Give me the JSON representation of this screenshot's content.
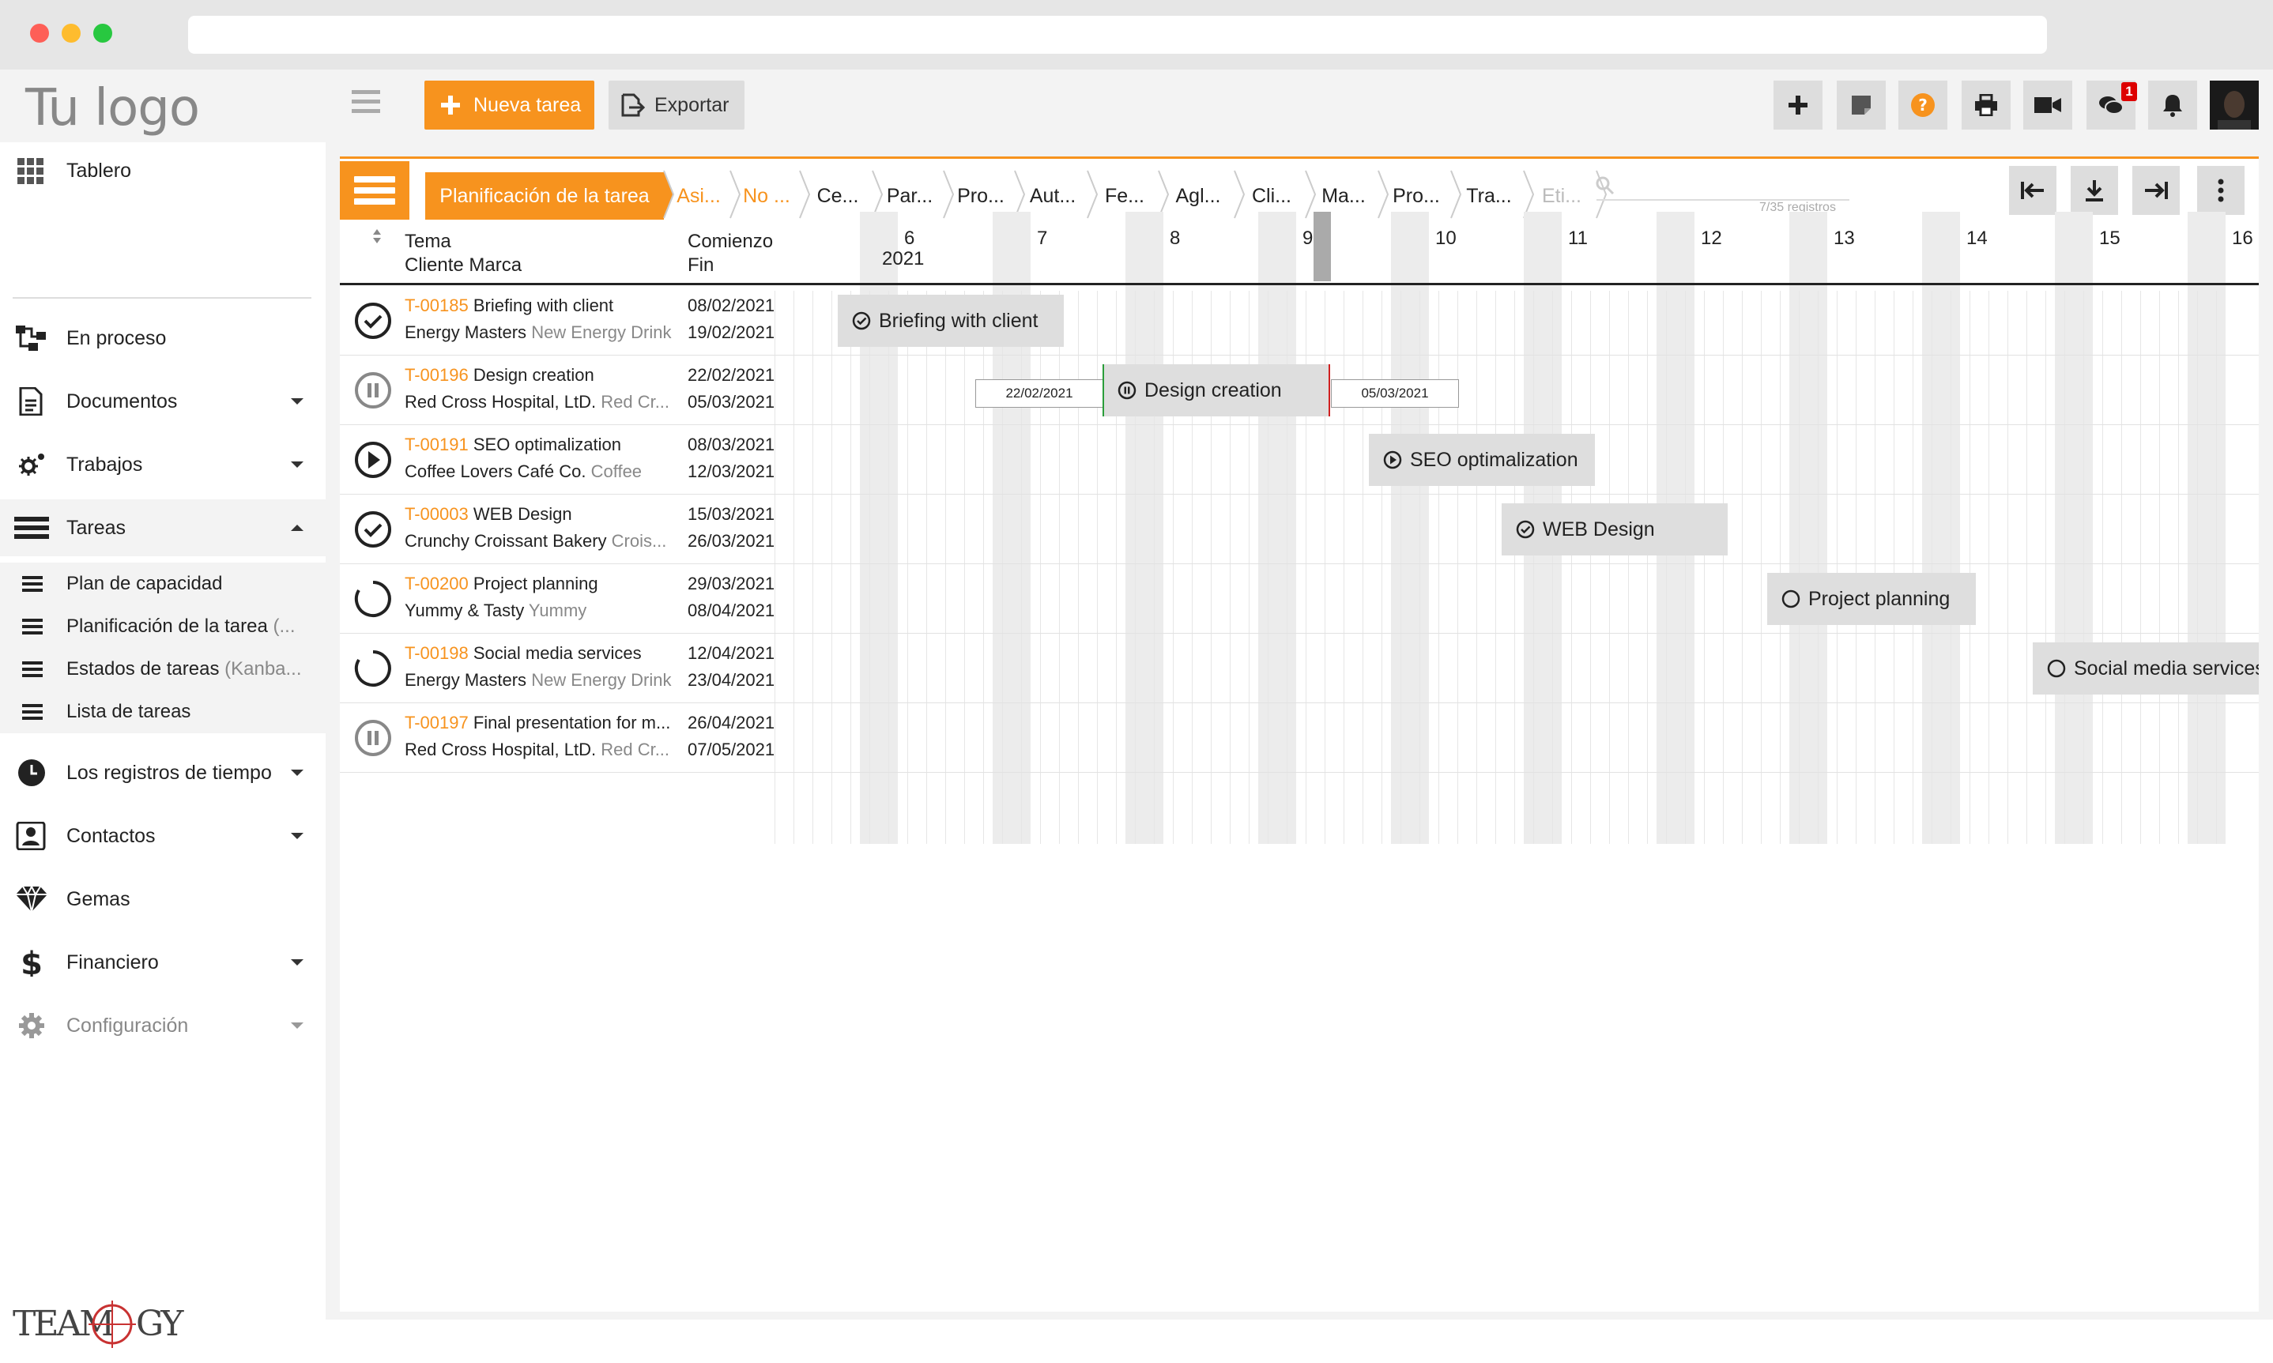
{
  "app": {
    "logo_text": "Tu logo",
    "brand_footer": "TEAMOGY",
    "accent": "#f7931e"
  },
  "toolbar": {
    "new_task_label": "Nueva tarea",
    "export_label": "Exportar",
    "notification_badge": "1",
    "icons": [
      "plus-icon",
      "sticky-note-icon",
      "help-icon",
      "print-icon",
      "video-icon",
      "chat-icon",
      "bell-icon"
    ]
  },
  "sidebar": {
    "items": [
      {
        "label": "Tablero"
      },
      {
        "label": "En proceso"
      },
      {
        "label": "Documentos"
      },
      {
        "label": "Trabajos"
      },
      {
        "label": "Tareas"
      },
      {
        "label": "Los registros de tiempo"
      },
      {
        "label": "Contactos"
      },
      {
        "label": "Gemas"
      },
      {
        "label": "Financiero"
      },
      {
        "label": "Configuración"
      }
    ],
    "sub": [
      {
        "label": "Plan de capacidad",
        "extra": ""
      },
      {
        "label": "Planificación de la tarea",
        "extra": "(..."
      },
      {
        "label": "Estados de tareas",
        "extra": "(Kanba..."
      },
      {
        "label": "Lista de tareas",
        "extra": ""
      }
    ]
  },
  "breadcrumbs": [
    "Planificación de la tarea",
    "Asi...",
    "No ...",
    "Ce...",
    "Par...",
    "Pro...",
    "Aut...",
    "Fe...",
    "Agl...",
    "Cli...",
    "Ma...",
    "Pro...",
    "Tra...",
    "Eti..."
  ],
  "records": "7/35 registros",
  "columns": {
    "tema": "Tema",
    "cliente_marca": "Cliente Marca",
    "comienzo": "Comienzo",
    "fin": "Fin"
  },
  "timeline": {
    "days": [
      "6",
      "7",
      "8",
      "9",
      "10",
      "11",
      "12",
      "13",
      "14",
      "15",
      "16"
    ],
    "year": "2021"
  },
  "tasks": [
    {
      "id": "T-00185",
      "title": "Briefing with client",
      "client": "Energy Masters",
      "brand": "New Energy Drink",
      "start": "08/02/2021",
      "end": "19/02/2021",
      "status": "done",
      "bar": "Briefing with client"
    },
    {
      "id": "T-00196",
      "title": "Design creation",
      "client": "Red Cross Hospital, LtD.",
      "brand": "Red Cr...",
      "start": "22/02/2021",
      "end": "05/03/2021",
      "status": "paused",
      "bar": "Design creation",
      "bar_start": "22/02/2021",
      "bar_end": "05/03/2021"
    },
    {
      "id": "T-00191",
      "title": "SEO optimalization",
      "client": "Coffee Lovers Café Co.",
      "brand": "Coffee",
      "start": "08/03/2021",
      "end": "12/03/2021",
      "status": "playing",
      "bar": "SEO optimalization"
    },
    {
      "id": "T-00003",
      "title": "WEB Design",
      "client": "Crunchy Croissant Bakery",
      "brand": "Crois...",
      "start": "15/03/2021",
      "end": "26/03/2021",
      "status": "done",
      "bar": "WEB Design"
    },
    {
      "id": "T-00200",
      "title": "Project planning",
      "client": "Yummy & Tasty",
      "brand": "Yummy",
      "start": "29/03/2021",
      "end": "08/04/2021",
      "status": "open",
      "bar": "Project planning"
    },
    {
      "id": "T-00198",
      "title": "Social media services",
      "client": "Energy Masters",
      "brand": "New Energy Drink",
      "start": "12/04/2021",
      "end": "23/04/2021",
      "status": "open",
      "bar": "Social media services"
    },
    {
      "id": "T-00197",
      "title": "Final presentation for m...",
      "client": "Red Cross Hospital, LtD.",
      "brand": "Red Cr...",
      "start": "26/04/2021",
      "end": "07/05/2021",
      "status": "paused",
      "bar": ""
    }
  ]
}
